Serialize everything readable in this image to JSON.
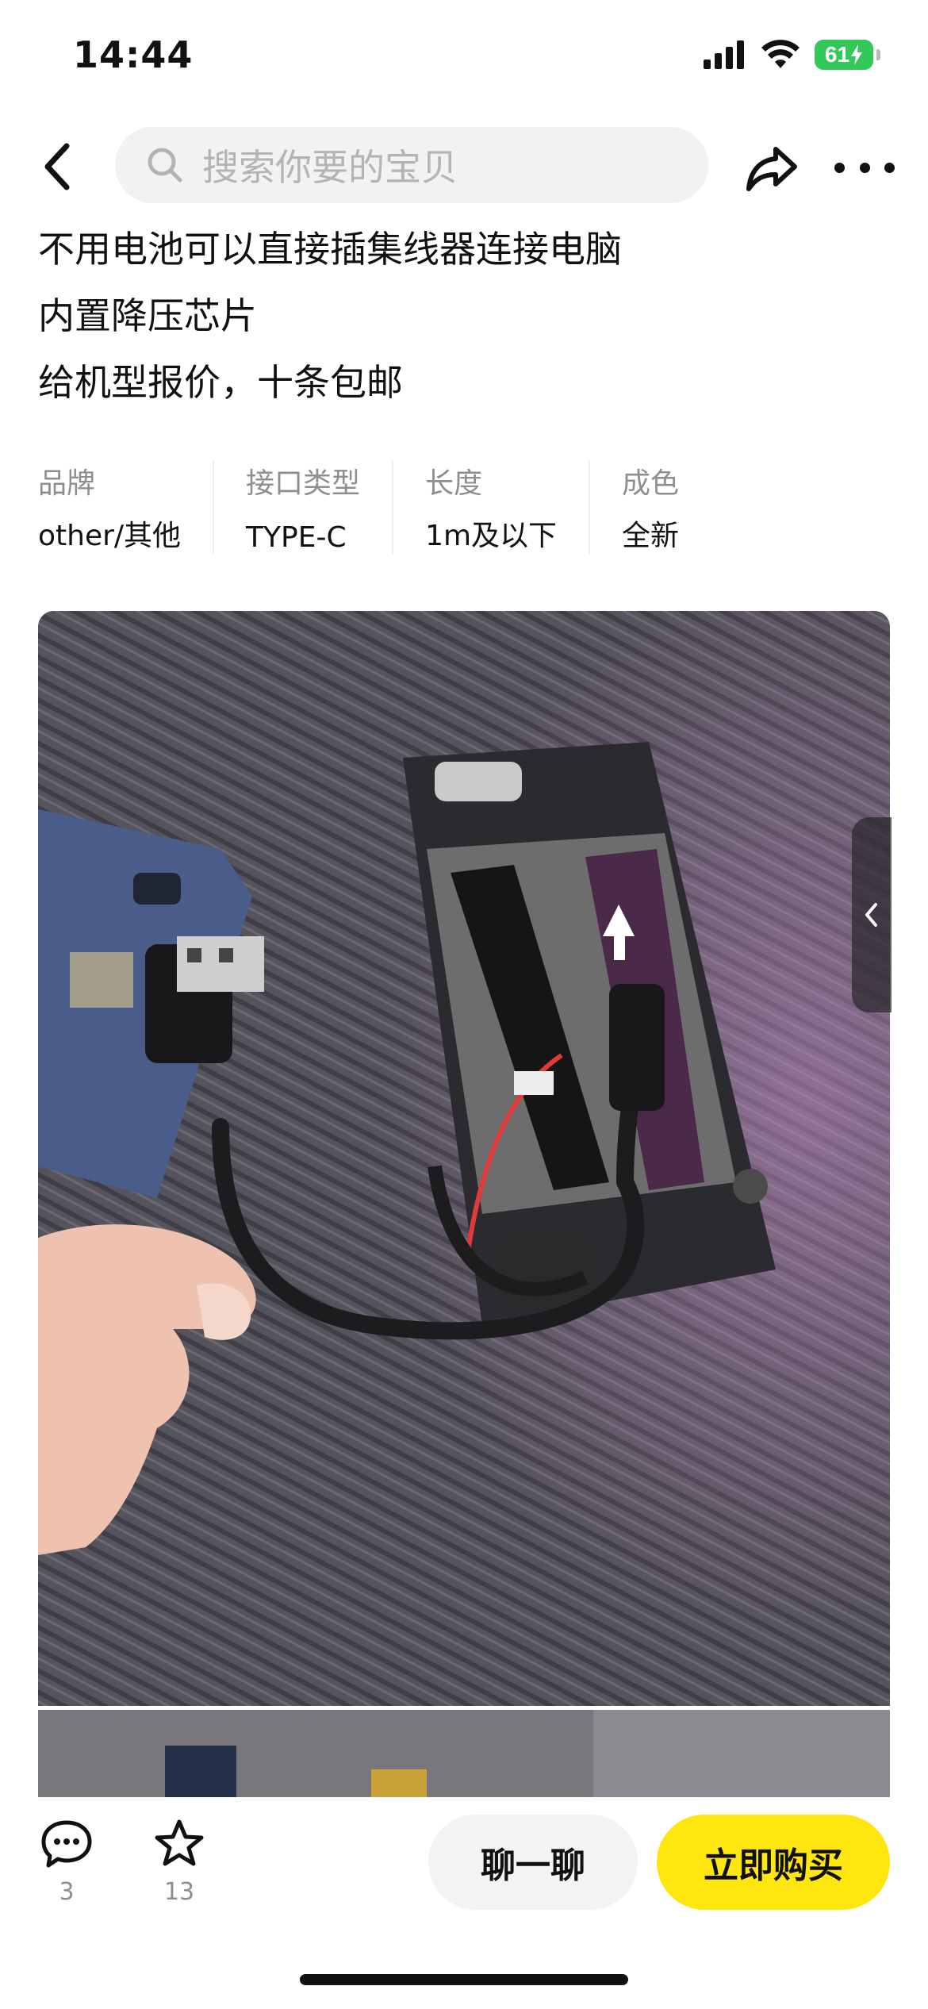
{
  "status_bar": {
    "time": "14:44",
    "battery": "61"
  },
  "nav": {
    "search_placeholder": "搜索你要的宝贝"
  },
  "description": {
    "lines": [
      "不用电池可以直接插集线器连接电脑",
      "内置降压芯片",
      "给机型报价，十条包邮"
    ]
  },
  "attributes": [
    {
      "label": "品牌",
      "value": "other/其他"
    },
    {
      "label": "接口类型",
      "value": "TYPE-C"
    },
    {
      "label": "长度",
      "value": "1m及以下"
    },
    {
      "label": "成色",
      "value": "全新"
    }
  ],
  "bottom_bar": {
    "comments_count": "3",
    "favorites_count": "13",
    "chat_label": "聊一聊",
    "buy_label": "立即购买"
  },
  "colors": {
    "accent_yellow": "#ffe60f",
    "battery_green": "#34c759"
  },
  "icons": {
    "back": "chevron-left-icon",
    "search": "search-icon",
    "share": "share-icon",
    "more": "more-icon",
    "comment": "comment-icon",
    "favorite": "star-icon"
  }
}
